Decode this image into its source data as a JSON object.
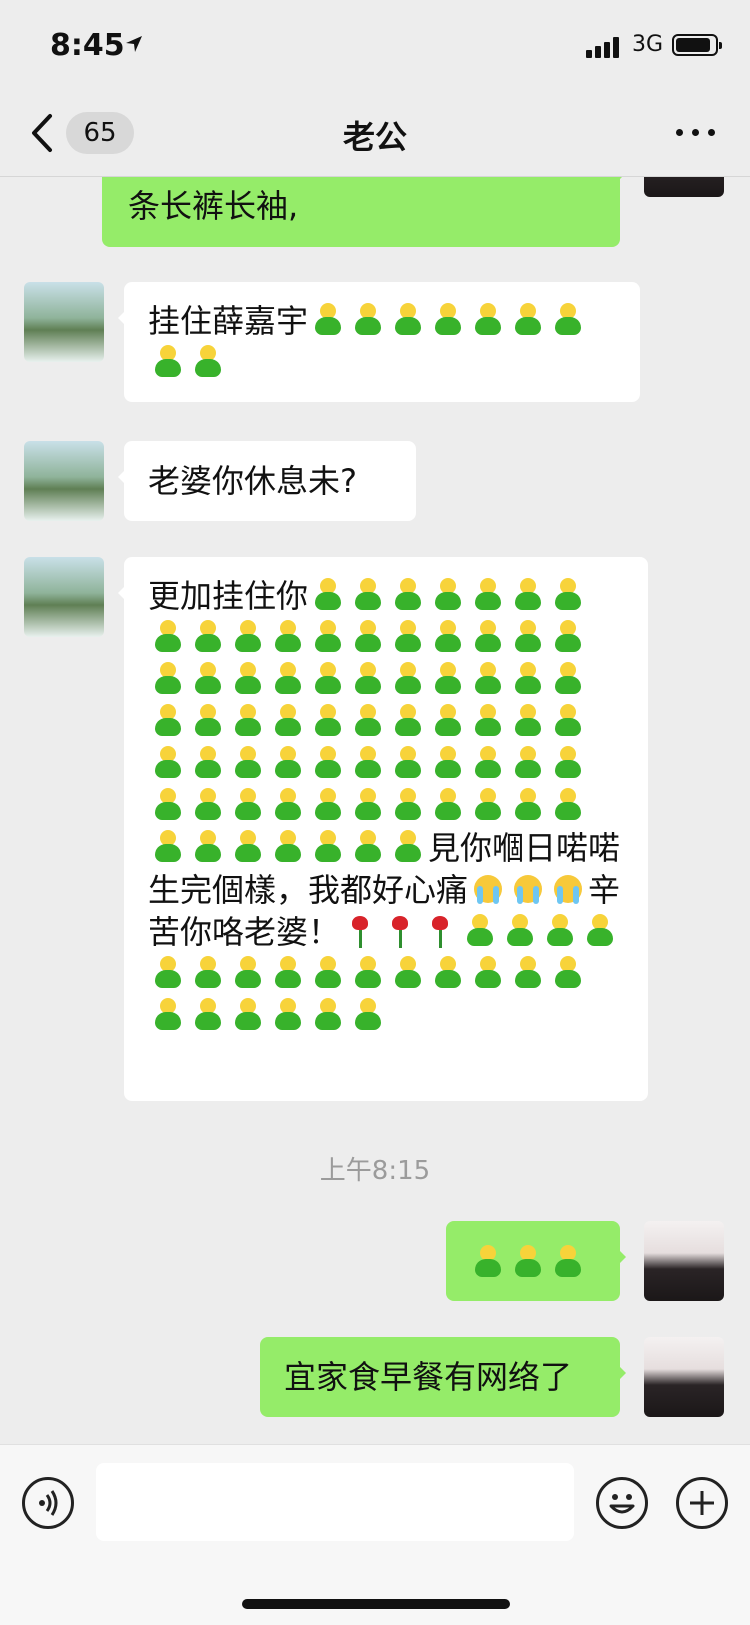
{
  "status_bar": {
    "time": "8:45",
    "network": "3G"
  },
  "nav": {
    "back_badge": "65",
    "title": "老公"
  },
  "messages": [
    {
      "side": "out",
      "text_lines": [
        "条长裤长袖,"
      ]
    },
    {
      "side": "in",
      "text": "挂住薛嘉宇",
      "emoji": "bean",
      "emoji_count": 9
    },
    {
      "side": "in",
      "text": "老婆你休息未?"
    },
    {
      "side": "in",
      "text_start": "更加挂住你",
      "text_mid": "見你嗰日喏喏生完個樣，我都好心痛",
      "text_end": "辛苦你咯老婆！"
    },
    {
      "side": "out",
      "emoji": "bean",
      "emoji_count": 3
    },
    {
      "side": "out",
      "text": "宜家食早餐有网络了"
    }
  ],
  "timestamp": "上午8:15"
}
